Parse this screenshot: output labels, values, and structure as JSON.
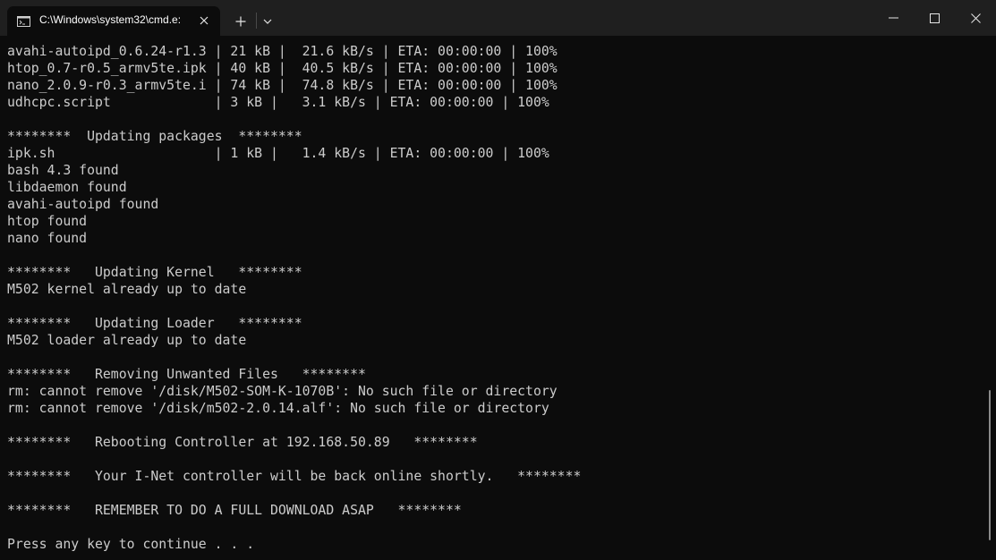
{
  "window": {
    "tab_title": "C:\\Windows\\system32\\cmd.e:",
    "tab_icon": "cmd-icon",
    "new_tab_icon": "plus-icon",
    "dropdown_icon": "chevron-down-icon",
    "minimize_icon": "minimize-icon",
    "maximize_icon": "maximize-icon",
    "close_icon": "close-icon"
  },
  "terminal": {
    "lines": [
      "avahi-autoipd_0.6.24-r1.3 | 21 kB |  21.6 kB/s | ETA: 00:00:00 | 100%",
      "htop_0.7-r0.5_armv5te.ipk | 40 kB |  40.5 kB/s | ETA: 00:00:00 | 100%",
      "nano_2.0.9-r0.3_armv5te.i | 74 kB |  74.8 kB/s | ETA: 00:00:00 | 100%",
      "udhcpc.script             | 3 kB |   3.1 kB/s | ETA: 00:00:00 | 100%",
      "",
      "********  Updating packages  ********",
      "ipk.sh                    | 1 kB |   1.4 kB/s | ETA: 00:00:00 | 100%",
      "bash 4.3 found",
      "libdaemon found",
      "avahi-autoipd found",
      "htop found",
      "nano found",
      "",
      "********   Updating Kernel   ********",
      "M502 kernel already up to date",
      "",
      "********   Updating Loader   ********",
      "M502 loader already up to date",
      "",
      "********   Removing Unwanted Files   ********",
      "rm: cannot remove '/disk/M502-SOM-K-1070B': No such file or directory",
      "rm: cannot remove '/disk/m502-2.0.14.alf': No such file or directory",
      "",
      "********   Rebooting Controller at 192.168.50.89   ********",
      "",
      "********   Your I-Net controller will be back online shortly.   ********",
      "",
      "********   REMEMBER TO DO A FULL DOWNLOAD ASAP   ********",
      "",
      "Press any key to continue . . ."
    ]
  },
  "colors": {
    "background": "#0c0c0c",
    "titlebar": "#1f1f1f",
    "text": "#cccccc"
  }
}
